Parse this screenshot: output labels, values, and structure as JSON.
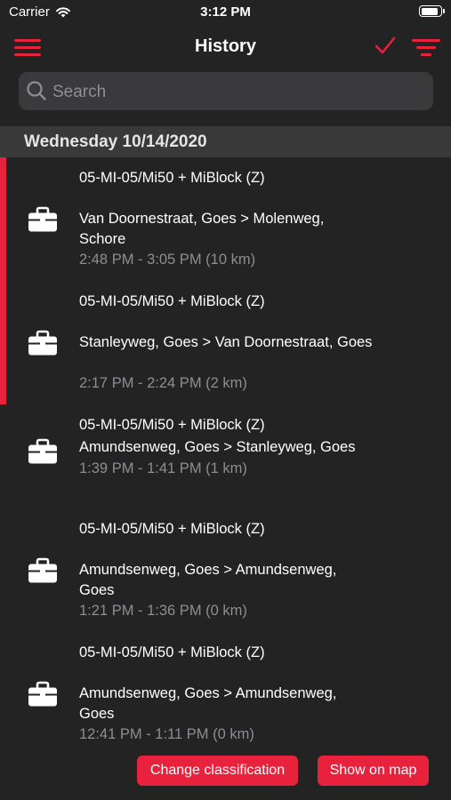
{
  "status_bar": {
    "carrier": "Carrier",
    "time": "3:12 PM"
  },
  "nav": {
    "title": "History"
  },
  "search": {
    "placeholder": "Search",
    "value": ""
  },
  "section": {
    "title": "Wednesday 10/14/2020"
  },
  "trips": [
    {
      "vehicle": "05-MI-05/Mi50 + MiBlock (Z)",
      "route": "Van Doornestraat, Goes > Molenweg, Schore",
      "time": "2:48 PM - 3:05 PM (10 km)",
      "icon": "briefcase-icon",
      "selected": true
    },
    {
      "vehicle": "05-MI-05/Mi50 + MiBlock (Z)",
      "route": "Stanleyweg, Goes > Van Doornestraat, Goes",
      "time": "2:17 PM - 2:24 PM (2 km)",
      "icon": "briefcase-icon",
      "selected": true
    },
    {
      "vehicle": "05-MI-05/Mi50 + MiBlock (Z)",
      "route": "Amundsenweg, Goes > Stanleyweg, Goes",
      "time": "1:39 PM - 1:41 PM (1 km)",
      "icon": "briefcase-icon",
      "selected": false
    },
    {
      "vehicle": "05-MI-05/Mi50 + MiBlock (Z)",
      "route": "Amundsenweg, Goes > Amundsenweg, Goes",
      "time": "1:21 PM - 1:36 PM (0 km)",
      "icon": "briefcase-icon",
      "selected": false
    },
    {
      "vehicle": "05-MI-05/Mi50 + MiBlock (Z)",
      "route": "Amundsenweg, Goes > Amundsenweg, Goes",
      "time": "12:41 PM - 1:11 PM (0 km)",
      "icon": "briefcase-icon",
      "selected": false
    }
  ],
  "actions": {
    "change_classification": "Change classification",
    "show_on_map": "Show on map"
  },
  "colors": {
    "accent": "#e8213c",
    "background": "#232323",
    "section_header": "#393939",
    "secondary_text": "#8e8e93"
  }
}
